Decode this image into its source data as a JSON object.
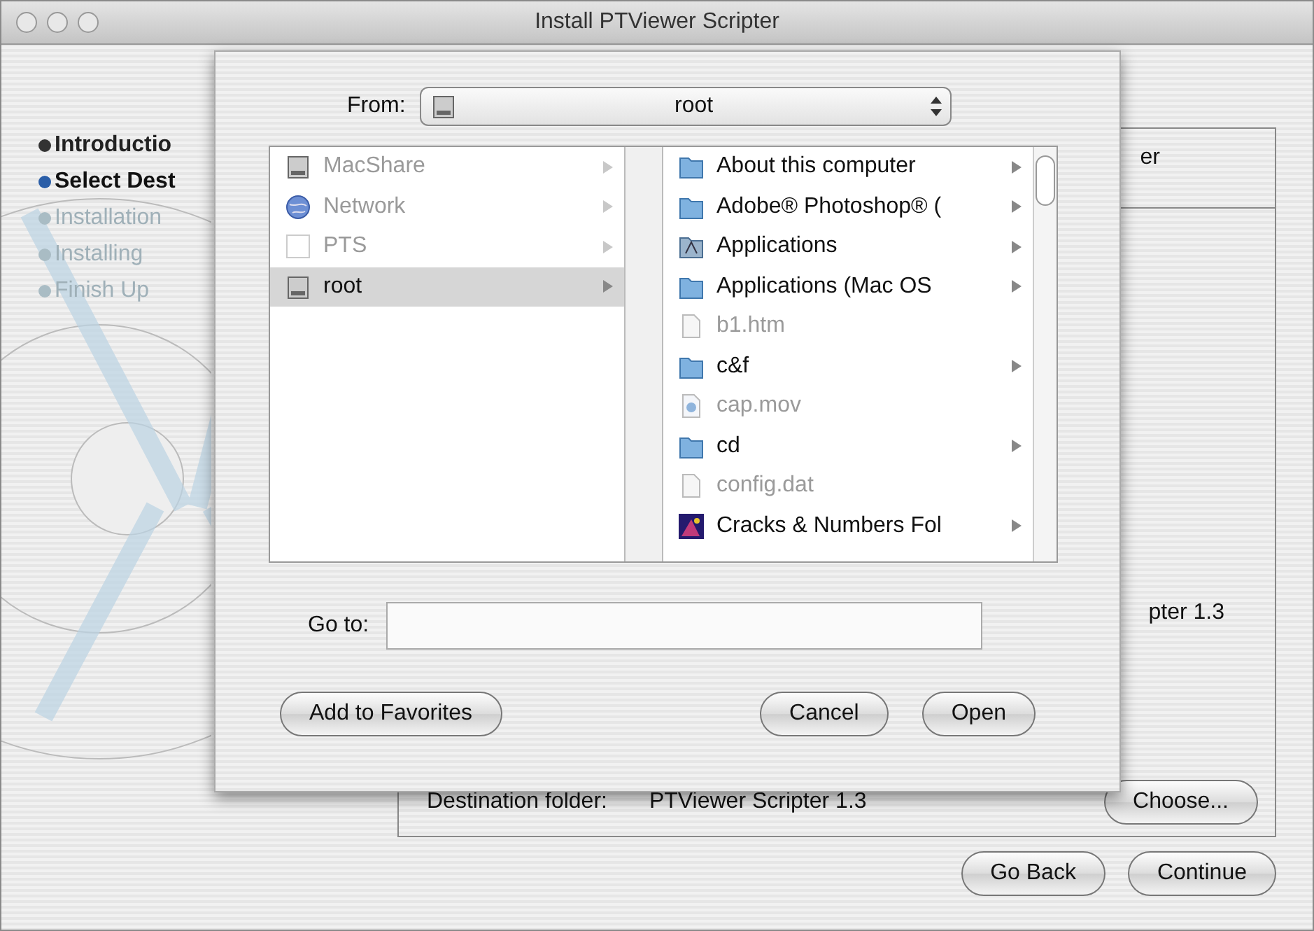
{
  "window": {
    "title": "Install PTViewer Scripter"
  },
  "steps": [
    {
      "label": "Introductio",
      "kind": "done"
    },
    {
      "label": "Select Dest",
      "kind": "current"
    },
    {
      "label": "Installation",
      "kind": "pending"
    },
    {
      "label": "Installing",
      "kind": "pending"
    },
    {
      "label": "Finish Up",
      "kind": "pending"
    }
  ],
  "panel": {
    "heading": "er",
    "summary": "pter 1.3",
    "destination_label": "Destination folder:",
    "destination_value": "PTViewer Scripter 1.3",
    "choose_button": "Choose..."
  },
  "buttons": [
    "Go Back",
    "Continue"
  ],
  "sheet": {
    "from_label": "From:",
    "from_value": "root",
    "sources": [
      {
        "name": "MacShare",
        "kind": "drive",
        "enabled": false,
        "selected": false
      },
      {
        "name": "Network",
        "kind": "network",
        "enabled": false,
        "selected": false
      },
      {
        "name": "PTS",
        "kind": "volume",
        "enabled": false,
        "selected": false
      },
      {
        "name": "root",
        "kind": "drive",
        "enabled": true,
        "selected": true
      }
    ],
    "files": [
      {
        "name": "About this computer",
        "kind": "folder",
        "enabled": true
      },
      {
        "name": "Adobe® Photoshop® (",
        "kind": "folder",
        "enabled": true
      },
      {
        "name": "Applications",
        "kind": "apps",
        "enabled": true
      },
      {
        "name": "Applications (Mac OS",
        "kind": "folder",
        "enabled": true
      },
      {
        "name": "b1.htm",
        "kind": "document",
        "enabled": false
      },
      {
        "name": "c&f",
        "kind": "folder",
        "enabled": true
      },
      {
        "name": "cap.mov",
        "kind": "movie",
        "enabled": false
      },
      {
        "name": "cd",
        "kind": "folder",
        "enabled": true
      },
      {
        "name": "config.dat",
        "kind": "document",
        "enabled": false
      },
      {
        "name": "Cracks & Numbers Fol",
        "kind": "image",
        "enabled": true
      }
    ],
    "goto_label": "Go to:",
    "buttons": [
      "Add to Favorites",
      "Cancel",
      "Open"
    ]
  }
}
